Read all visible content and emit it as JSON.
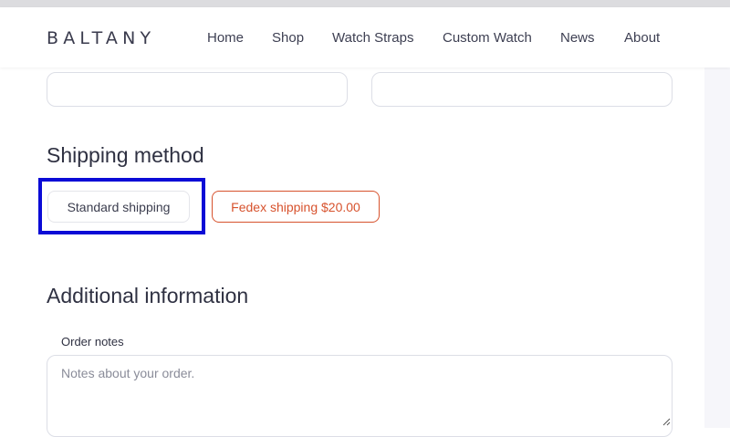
{
  "header": {
    "logo": "BALTANY",
    "nav": [
      {
        "label": "Home",
        "name": "nav-home"
      },
      {
        "label": "Shop",
        "name": "nav-shop"
      },
      {
        "label": "Watch Straps",
        "name": "nav-watch-straps"
      },
      {
        "label": "Custom Watch",
        "name": "nav-custom-watch"
      },
      {
        "label": "News",
        "name": "nav-news"
      },
      {
        "label": "About",
        "name": "nav-about"
      }
    ]
  },
  "shipping": {
    "title": "Shipping method",
    "options": [
      {
        "label": "Standard shipping",
        "selected": true
      },
      {
        "label": "Fedex shipping $20.00",
        "selected": false
      }
    ]
  },
  "additional": {
    "title": "Additional information",
    "order_notes_label": "Order notes",
    "order_notes_placeholder": "Notes about your order."
  },
  "colors": {
    "accent": "#d7522d",
    "highlight": "#0b0bd6",
    "text": "#2f3142"
  }
}
